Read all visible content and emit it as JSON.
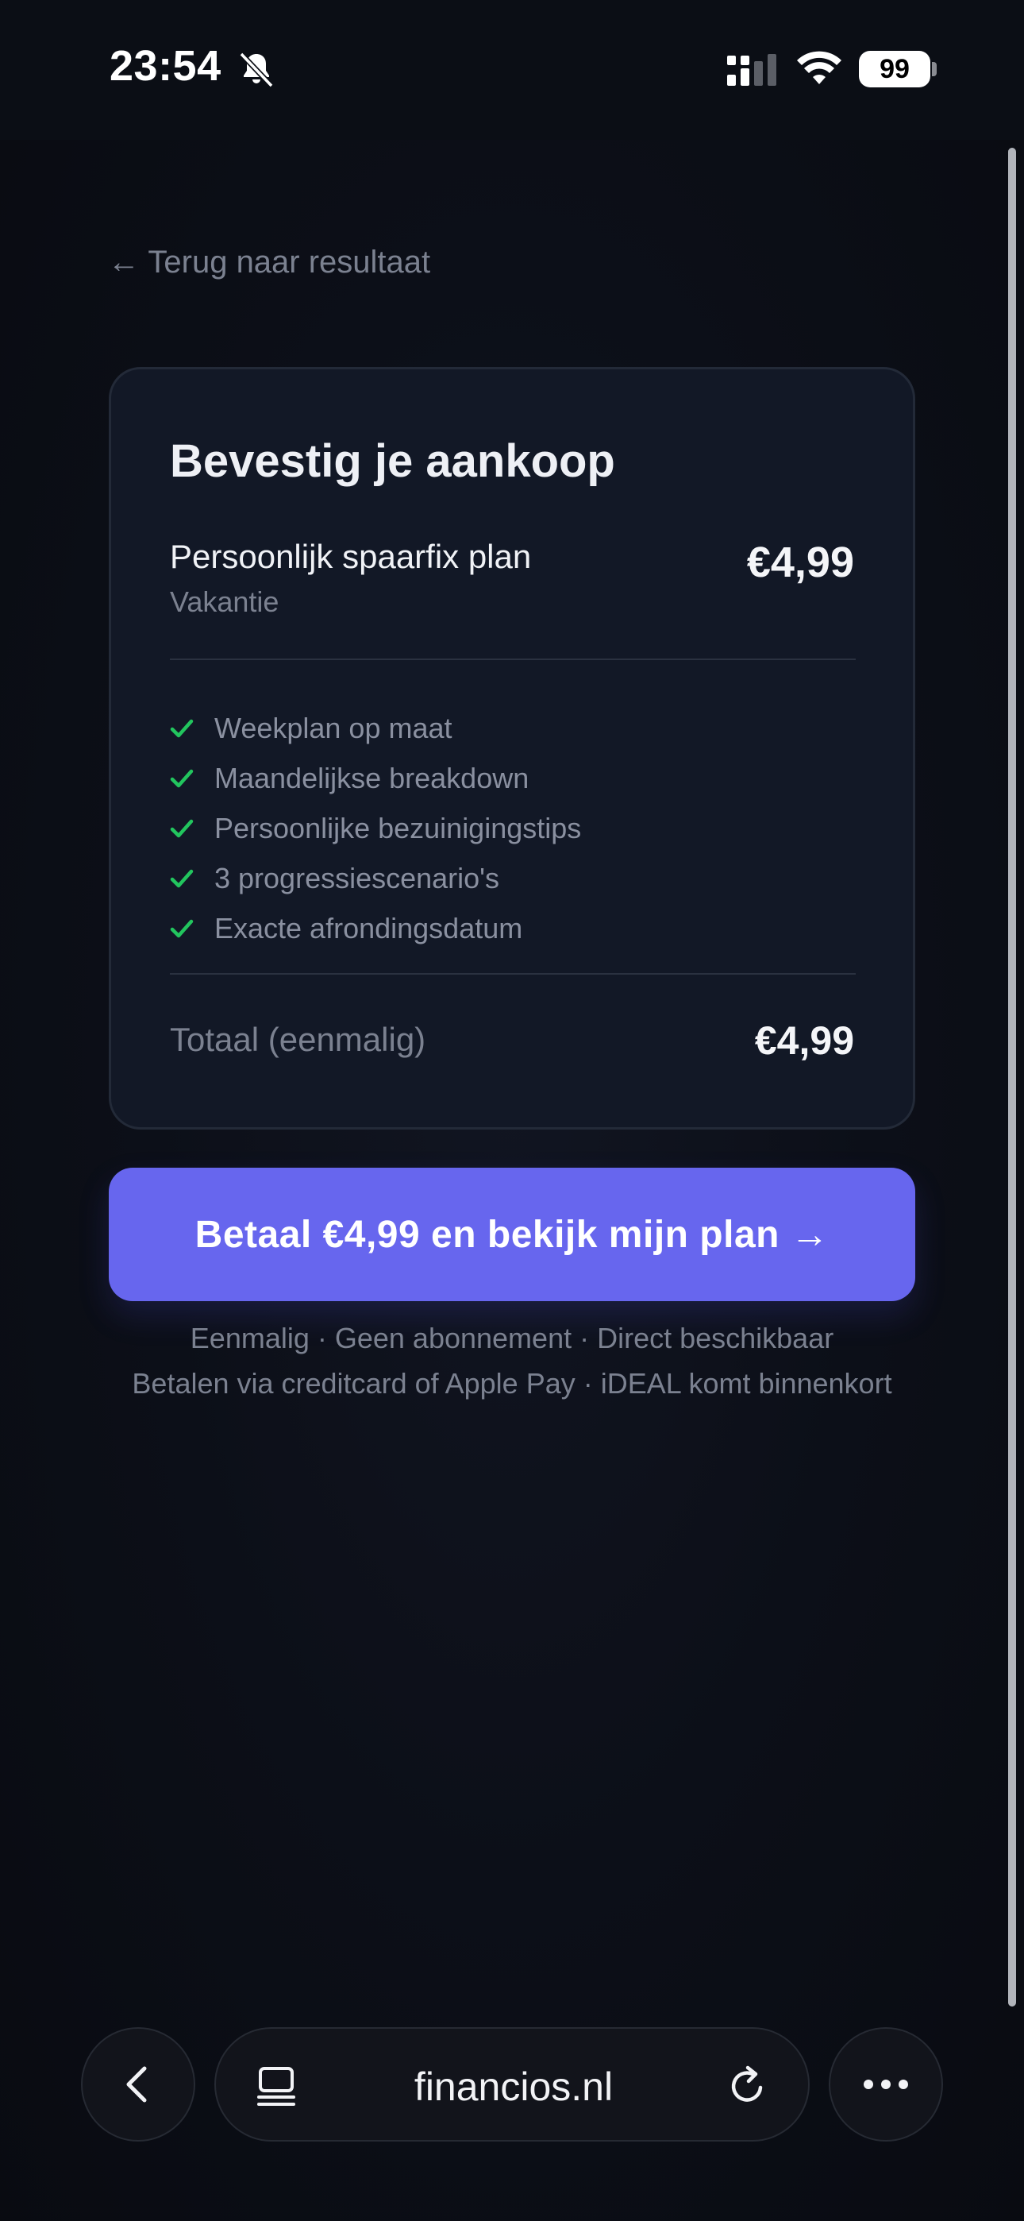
{
  "status_bar": {
    "time": "23:54",
    "battery": "99"
  },
  "back_link": "← Terug naar resultaat",
  "card": {
    "title": "Bevestig je aankoop",
    "product_name": "Persoonlijk spaarfix plan",
    "product_category": "Vakantie",
    "product_price": "€4,99",
    "features": [
      "Weekplan op maat",
      "Maandelijkse breakdown",
      "Persoonlijke bezuinigingstips",
      "3 progressiescenario's",
      "Exacte afrondingsdatum"
    ],
    "total_label": "Totaal (eenmalig)",
    "total_price": "€4,99"
  },
  "pay_button": "Betaal €4,99 en bekijk mijn plan →",
  "fine_print": {
    "line1": "Eenmalig · Geen abonnement · Direct beschikbaar",
    "line2": "Betalen via creditcard of Apple Pay · iDEAL komt binnenkort"
  },
  "browser": {
    "url": "financios.nl"
  },
  "colors": {
    "accent": "#6766ee",
    "check": "#22c55e",
    "background": "#0a0d14",
    "card": "#121826"
  },
  "icons": [
    "bell-slash-icon",
    "signal-icon",
    "wifi-icon",
    "battery-icon",
    "check-icon",
    "chevron-left-icon",
    "tabs-icon",
    "reload-icon",
    "more-icon"
  ]
}
